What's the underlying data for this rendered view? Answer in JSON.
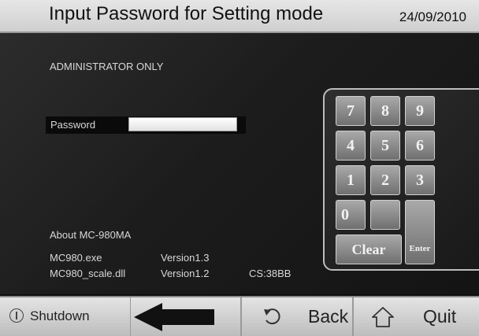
{
  "header": {
    "title": "Input Password for Setting mode",
    "date": "24/09/2010"
  },
  "main": {
    "admin_notice": "ADMINISTRATOR ONLY",
    "password_label": "Password",
    "password_value": "",
    "about_label": "About MC-980MA",
    "files": [
      {
        "name": "MC980.exe",
        "version": "Version1.3"
      },
      {
        "name": "MC980_scale.dll",
        "version": "Version1.2"
      }
    ],
    "checksum": "CS:38BB"
  },
  "keypad": {
    "keys": [
      "7",
      "8",
      "9",
      "4",
      "5",
      "6",
      "1",
      "2",
      "3",
      "0"
    ],
    "clear_label": "Clear",
    "enter_label": "Enter"
  },
  "footer": {
    "shutdown_label": "Shutdown",
    "back_label": "Back",
    "quit_label": "Quit"
  },
  "icons": {
    "shutdown": "power-icon",
    "arrow": "left-arrow-icon",
    "back": "undo-icon",
    "quit": "home-icon"
  },
  "colors": {
    "background": "#0f0f0f",
    "header": "#d8d8d8",
    "key": "#8a8a8a",
    "footer": "#cfcfcf"
  }
}
